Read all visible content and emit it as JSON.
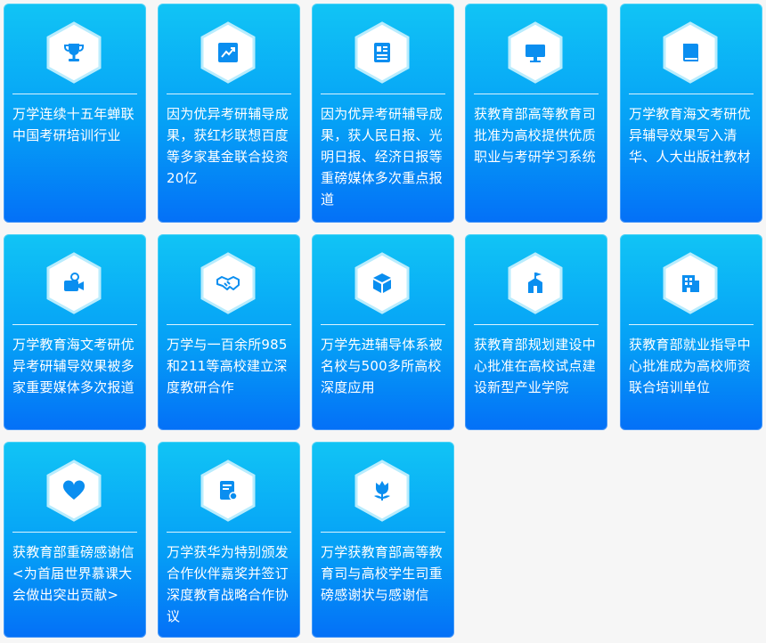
{
  "cards": [
    {
      "icon": "trophy-icon",
      "text": "万学连续十五年蝉联中国考研培训行业"
    },
    {
      "icon": "chart-up-icon",
      "text": "因为优异考研辅导成果，获红杉联想百度等多家基金联合投资20亿"
    },
    {
      "icon": "newspaper-icon",
      "text": "因为优异考研辅导成果，获人民日报、光明日报、经济日报等重磅媒体多次重点报道"
    },
    {
      "icon": "monitor-icon",
      "text": "获教育部高等教育司批准为高校提供优质职业与考研学习系统"
    },
    {
      "icon": "book-icon",
      "text": "万学教育海文考研优异辅导效果写入清华、人大出版社教材"
    },
    {
      "icon": "video-camera-icon",
      "text": "万学教育海文考研优异考研辅导效果被多家重要媒体多次报道"
    },
    {
      "icon": "handshake-icon",
      "text": "万学与一百余所985和211等高校建立深度教研合作"
    },
    {
      "icon": "cube-icon",
      "text": "万学先进辅导体系被名校与500多所高校深度应用"
    },
    {
      "icon": "school-icon",
      "text": "获教育部规划建设中心批准在高校试点建设新型产业学院"
    },
    {
      "icon": "building-icon",
      "text": "获教育部就业指导中心批准成为高校师资联合培训单位"
    },
    {
      "icon": "heart-icon",
      "text": "获教育部重磅感谢信<为首届世界慕课大会做出突出贡献>"
    },
    {
      "icon": "certificate-icon",
      "text": "万学获华为特别颁发合作伙伴嘉奖并签订深度教育战略合作协议"
    },
    {
      "icon": "tulip-icon",
      "text": "万学获教育部高等教育司与高校学生司重磅感谢状与感谢信"
    }
  ]
}
